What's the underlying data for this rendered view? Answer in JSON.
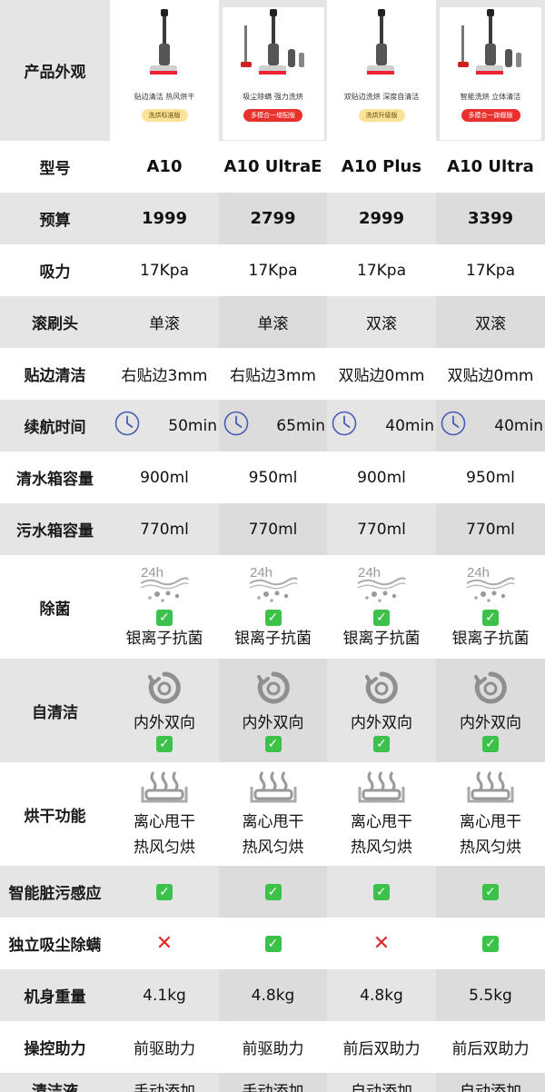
{
  "header": {
    "label": "产品外观",
    "products": [
      {
        "desc": "贴边清洁 热风烘干",
        "badge": "洗烘标准版",
        "badge_color": "#fbe39a"
      },
      {
        "desc": "吸尘除螨 强力洗烘",
        "badge": "多模合一增配版",
        "badge_color": "#e8302c"
      },
      {
        "desc": "双贴边洗烘 深度自清洁",
        "badge": "洗烘升级版",
        "badge_color": "#fbe39a"
      },
      {
        "desc": "智能洗烘 立体清洁",
        "badge": "多模合一旗舰版",
        "badge_color": "#e8302c"
      }
    ]
  },
  "rows": {
    "model": {
      "label": "型号",
      "values": [
        "A10",
        "A10 UltraE",
        "A10 Plus",
        "A10 Ultra"
      ]
    },
    "budget": {
      "label": "预算",
      "values": [
        "1999",
        "2799",
        "2999",
        "3399"
      ]
    },
    "suction": {
      "label": "吸力",
      "values": [
        "17Kpa",
        "17Kpa",
        "17Kpa",
        "17Kpa"
      ]
    },
    "brush": {
      "label": "滚刷头",
      "values": [
        "单滚",
        "单滚",
        "双滚",
        "双滚"
      ]
    },
    "edge": {
      "label": "贴边清洁",
      "values": [
        "右贴边3mm",
        "右贴边3mm",
        "双贴边0mm",
        "双贴边0mm"
      ]
    },
    "runtime": {
      "label": "续航时间",
      "icon": "clock-icon",
      "values": [
        "50min",
        "65min",
        "40min",
        "40min"
      ]
    },
    "clean_tank": {
      "label": "清水箱容量",
      "values": [
        "900ml",
        "950ml",
        "900ml",
        "950ml"
      ]
    },
    "dirty_tank": {
      "label": "污水箱容量",
      "values": [
        "770ml",
        "770ml",
        "770ml",
        "770ml"
      ]
    },
    "sterilize": {
      "label": "除菌",
      "icon": "24h-sterilize-icon",
      "icon_text": "24h",
      "values": [
        "银离子抗菌",
        "银离子抗菌",
        "银离子抗菌",
        "银离子抗菌"
      ]
    },
    "self_clean": {
      "label": "自清洁",
      "icon": "rotate-clean-icon",
      "values": [
        "内外双向",
        "内外双向",
        "内外双向",
        "内外双向"
      ]
    },
    "drying": {
      "label": "烘干功能",
      "icon": "heating-icon",
      "line1": [
        "离心甩干",
        "离心甩干",
        "离心甩干",
        "离心甩干"
      ],
      "line2": [
        "热风匀烘",
        "热风匀烘",
        "热风匀烘",
        "热风匀烘"
      ]
    },
    "dirt_sense": {
      "label": "智能脏污感应",
      "values": [
        "check",
        "check",
        "check",
        "check"
      ]
    },
    "dust": {
      "label": "独立吸尘除螨",
      "values": [
        "cross",
        "check",
        "cross",
        "check"
      ]
    },
    "weight": {
      "label": "机身重量",
      "values": [
        "4.1kg",
        "4.8kg",
        "4.8kg",
        "5.5kg"
      ]
    },
    "assist": {
      "label": "操控助力",
      "values": [
        "前驱助力",
        "前驱助力",
        "前后双助力",
        "前后双助力"
      ]
    },
    "solution": {
      "label": "清洁液",
      "values": [
        "手动添加",
        "手动添加",
        "自动添加",
        "自动添加"
      ]
    }
  },
  "marks": {
    "check": "✓",
    "cross": "✕"
  },
  "colors": {
    "check_green": "#3cc24a",
    "cross_red": "#e0282a",
    "gray_row": "#e5e5e5",
    "icon_gray": "#9a9a9a",
    "clock_blue": "#4a5bb3"
  }
}
